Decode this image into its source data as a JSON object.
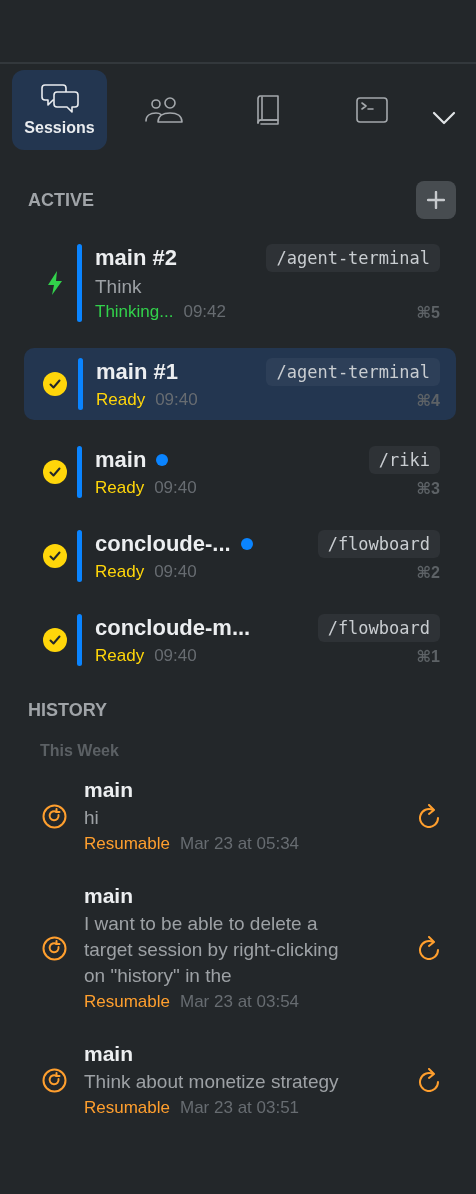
{
  "tabs": [
    {
      "kind": "sessions",
      "label": "Sessions",
      "selected": true
    },
    {
      "kind": "people",
      "selected": false
    },
    {
      "kind": "book",
      "selected": false
    },
    {
      "kind": "terminal",
      "selected": false
    }
  ],
  "active": {
    "title": "ACTIVE",
    "sessions": [
      {
        "kind": "thinking",
        "name": "main #2",
        "preview": "Think",
        "unread": false,
        "path": "/agent-terminal",
        "status_text": "Thinking...",
        "time": "09:42",
        "shortcut": "⌘5",
        "selected": false
      },
      {
        "kind": "ready",
        "name": "main #1",
        "unread": false,
        "path": "/agent-terminal",
        "status_text": "Ready",
        "time": "09:40",
        "shortcut": "⌘4",
        "selected": true
      },
      {
        "kind": "ready",
        "name": "main",
        "unread": true,
        "path": "/riki",
        "status_text": "Ready",
        "time": "09:40",
        "shortcut": "⌘3",
        "selected": false
      },
      {
        "kind": "ready",
        "name": "concloude-...",
        "unread": true,
        "path": "/flowboard",
        "status_text": "Ready",
        "time": "09:40",
        "shortcut": "⌘2",
        "selected": false
      },
      {
        "kind": "ready",
        "name": "concloude-m...",
        "unread": false,
        "path": "/flowboard",
        "status_text": "Ready",
        "time": "09:40",
        "shortcut": "⌘1",
        "selected": false
      }
    ]
  },
  "history": {
    "title": "HISTORY",
    "groups": [
      {
        "label": "This Week",
        "items": [
          {
            "name": "main",
            "preview": "hi",
            "status_text": "Resumable",
            "date": "Mar 23 at 05:34"
          },
          {
            "name": "main",
            "preview": "I want to be able to delete a target session by right-clicking on \"history\" in the",
            "status_text": "Resumable",
            "date": "Mar 23 at 03:54"
          },
          {
            "name": "main",
            "preview": "Think about monetize strategy",
            "status_text": "Resumable",
            "date": "Mar 23 at 03:51"
          }
        ]
      }
    ]
  }
}
